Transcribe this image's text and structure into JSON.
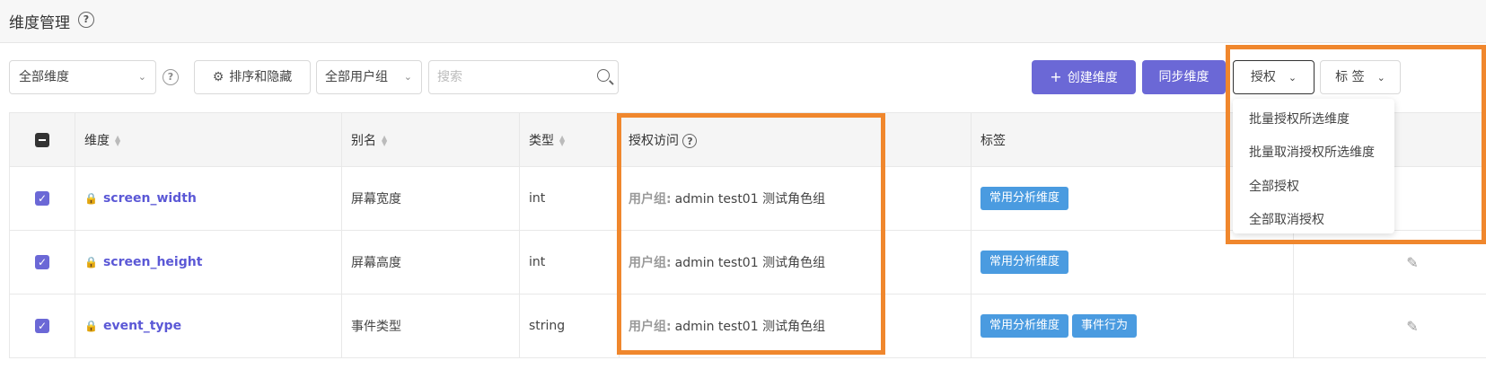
{
  "header": {
    "title": "维度管理"
  },
  "toolbar": {
    "dimension_filter": "全部维度",
    "sort_hide_label": "排序和隐藏",
    "usergroup_filter": "全部用户组",
    "search_placeholder": "搜索",
    "create_label": "创建维度",
    "sync_label": "同步维度",
    "auth_label": "授权",
    "tag_label": "标 签"
  },
  "table": {
    "columns": [
      "维度",
      "别名",
      "类型",
      "授权访问",
      "标签"
    ],
    "usergroup_label": "用户组:",
    "rows": [
      {
        "name": "screen_width",
        "alias": "屏幕宽度",
        "type": "int",
        "access": "admin test01 测试角色组",
        "tags": [
          "常用分析维度"
        ]
      },
      {
        "name": "screen_height",
        "alias": "屏幕高度",
        "type": "int",
        "access": "admin test01 测试角色组",
        "tags": [
          "常用分析维度"
        ]
      },
      {
        "name": "event_type",
        "alias": "事件类型",
        "type": "string",
        "access": "admin test01 测试角色组",
        "tags": [
          "常用分析维度",
          "事件行为"
        ]
      }
    ]
  },
  "auth_menu": {
    "items": [
      "批量授权所选维度",
      "批量取消授权所选维度",
      "全部授权",
      "全部取消授权"
    ]
  },
  "colors": {
    "accent": "#6b68d6",
    "tag": "#4a9be0",
    "highlight": "#f0872d",
    "lock": "#e0444a"
  }
}
